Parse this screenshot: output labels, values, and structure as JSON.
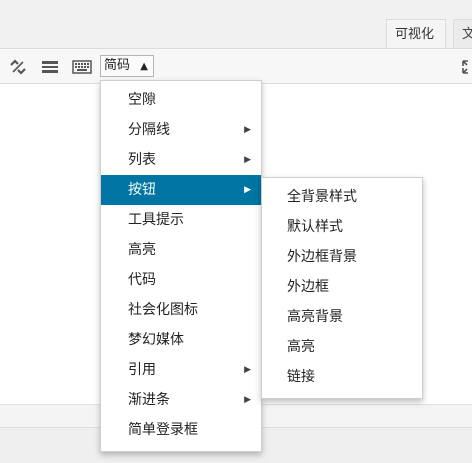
{
  "tabs": {
    "visual": "可视化",
    "text": "文"
  },
  "toolbar": {
    "shortcode_label": "简码",
    "shortcode_caret": "▲",
    "icons": [
      "unlink-icon",
      "horizontal-rule-icon",
      "keyboard-toolbar-icon",
      "expand-icon"
    ]
  },
  "menu": {
    "items": [
      {
        "label": "空隙",
        "submenu": false
      },
      {
        "label": "分隔线",
        "submenu": true
      },
      {
        "label": "列表",
        "submenu": true
      },
      {
        "label": "按钮",
        "submenu": true,
        "active": true
      },
      {
        "label": "工具提示",
        "submenu": false
      },
      {
        "label": "高亮",
        "submenu": false
      },
      {
        "label": "代码",
        "submenu": false
      },
      {
        "label": "社会化图标",
        "submenu": false
      },
      {
        "label": "梦幻媒体",
        "submenu": false
      },
      {
        "label": "引用",
        "submenu": true
      },
      {
        "label": "渐进条",
        "submenu": true
      },
      {
        "label": "简单登录框",
        "submenu": false
      }
    ],
    "arrow": "▶"
  },
  "submenu": {
    "items": [
      "全背景样式",
      "默认样式",
      "外边框背景",
      "外边框",
      "高亮背景",
      "高亮",
      "链接"
    ]
  },
  "colors": {
    "active_bg": "#0074a2",
    "active_text": "#ffffff"
  }
}
